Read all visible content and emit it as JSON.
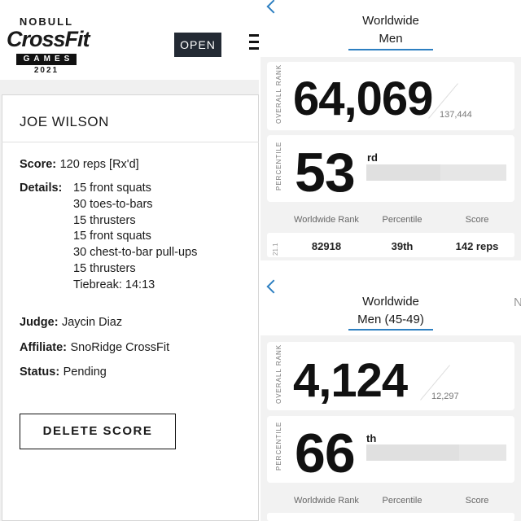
{
  "left": {
    "logo": {
      "line1": "NOBULL",
      "line2": "CrossFit",
      "line3": "GAMES",
      "line4": "2021"
    },
    "open_button": "OPEN",
    "athlete_name": "JOE WILSON",
    "score_label": "Score:",
    "score_value": "120 reps [Rx'd]",
    "details_label": "Details:",
    "details": [
      "15 front squats",
      "30 toes-to-bars",
      "15 thrusters",
      "15 front squats",
      "30 chest-to-bar pull-ups",
      "15 thrusters",
      "Tiebreak: 14:13"
    ],
    "judge_label": "Judge:",
    "judge_value": "Jaycin Diaz",
    "affiliate_label": "Affiliate:",
    "affiliate_value": "SnoRidge CrossFit",
    "status_label": "Status:",
    "status_value": "Pending",
    "delete_button": "DELETE SCORE"
  },
  "right": {
    "top": {
      "title_line1": "Worldwide",
      "title_line2": "Men",
      "overall_rank_label": "OVERALL RANK",
      "rank": "64,069",
      "total": "137,444",
      "percentile_label": "PERCENTILE",
      "percentile": "53",
      "percentile_suffix": "rd",
      "percentile_fill": 0.53,
      "columns": [
        "Worldwide Rank",
        "Percentile",
        "Score"
      ],
      "event": "21.1",
      "row": [
        "82918",
        "39th",
        "142 reps"
      ]
    },
    "bottom": {
      "title_line1": "Worldwide",
      "title_line2": "Men (45-49)",
      "next_tab_peek": "N",
      "overall_rank_label": "OVERALL RANK",
      "rank": "4,124",
      "total": "12,297",
      "percentile_label": "PERCENTILE",
      "percentile": "66",
      "percentile_suffix": "th",
      "percentile_fill": 0.66,
      "columns": [
        "Worldwide Rank",
        "Percentile",
        "Score"
      ]
    }
  },
  "colors": {
    "accent": "#2d7fc1",
    "button_dark": "#232a34",
    "panel_bg": "#f2f2f2"
  }
}
